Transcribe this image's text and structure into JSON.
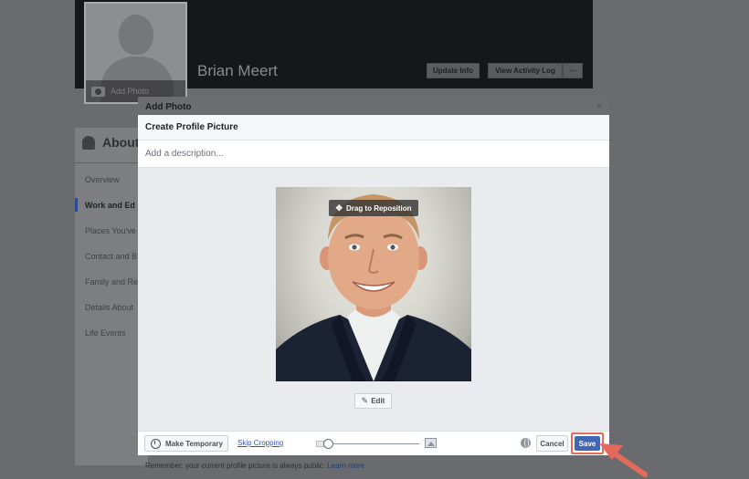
{
  "background": {
    "profile_name": "Brian Meert",
    "add_photo_label": "Add Photo",
    "buttons": {
      "update_info": "Update Info",
      "view_activity_log": "View Activity Log",
      "more": "···"
    },
    "about": {
      "title": "About",
      "items": [
        "Overview",
        "Work and Ed",
        "Places You've",
        "Contact and B",
        "Family and Re",
        "Details About",
        "Life Events"
      ],
      "active_index": 1
    }
  },
  "dialog": {
    "outer_title": "Add Photo",
    "close_label": "×",
    "header_title": "Create Profile Picture",
    "description_placeholder": "Add a description...",
    "drag_label": "Drag to Reposition",
    "edit_label": "Edit",
    "footer": {
      "make_temporary": "Make Temporary",
      "skip_cropping": "Skip Cropping",
      "zoom_level": 0.0,
      "cancel": "Cancel",
      "save": "Save"
    },
    "remember_text": "Remember: your current profile picture is always public.",
    "learn_more": "Learn more"
  },
  "colors": {
    "save_blue": "#4267b2",
    "highlight_red": "#e46a5c",
    "link_blue": "#365899"
  },
  "icons": [
    "camera-icon",
    "person-icon",
    "move-icon",
    "magic-wand-icon",
    "clock-icon",
    "small-image-icon",
    "large-image-icon",
    "globe-icon",
    "close-icon",
    "arrow-icon"
  ]
}
